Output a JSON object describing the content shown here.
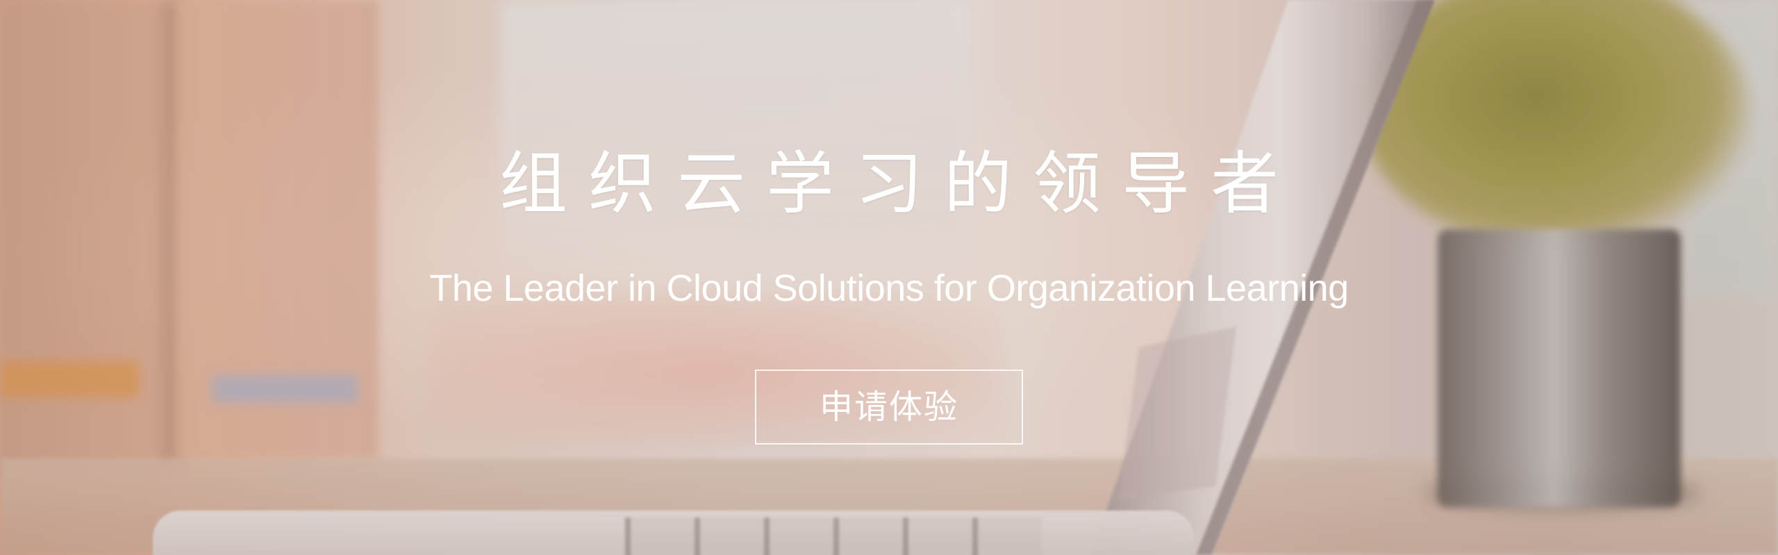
{
  "hero": {
    "title": "组织云学习的领导者",
    "subtitle": "The Leader in Cloud Solutions for Organization Learning",
    "cta_label": "申请体验"
  },
  "colors": {
    "text": "#ffffff",
    "button_border": "#ffffff"
  },
  "icons": {
    "background": "blurred-office-laptop-plant-photo"
  }
}
